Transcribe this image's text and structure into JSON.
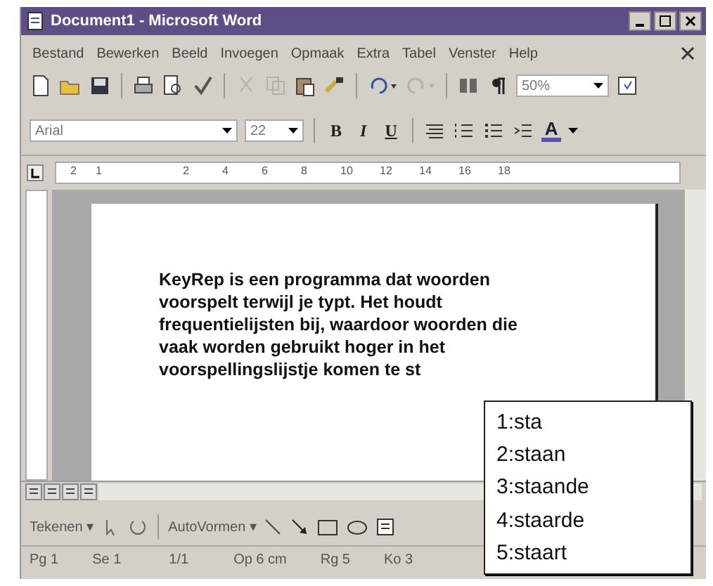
{
  "window": {
    "title": "Document1 - Microsoft Word"
  },
  "menu": [
    "Bestand",
    "Bewerken",
    "Beeld",
    "Invoegen",
    "Opmaak",
    "Extra",
    "Tabel",
    "Venster",
    "Help"
  ],
  "standard_toolbar": {
    "zoom": "50%"
  },
  "formatting_toolbar": {
    "font": "Arial",
    "size": "22",
    "style_buttons": [
      "B",
      "I",
      "U"
    ],
    "font_color_button": "A"
  },
  "ruler": {
    "labels": [
      "2",
      "1",
      "2",
      "4",
      "6",
      "8",
      "10",
      "12",
      "14",
      "16",
      "18"
    ]
  },
  "document": {
    "lines": [
      "KeyRep is een programma dat woorden",
      "voorspelt terwijl je typt. Het houdt",
      "frequentielijsten bij, waardoor woorden die",
      "vaak worden gebruikt hoger in het",
      "voorspellingslijstje komen te st"
    ]
  },
  "drawing_toolbar": {
    "draw_menu": "Tekenen ▾",
    "autoshapes_menu": "AutoVormen ▾"
  },
  "status_bar": [
    "Pg 1",
    "Se 1",
    "1/1",
    "Op 6 cm",
    "Rg 5",
    "Ko 3"
  ],
  "prediction_list": [
    "1:sta",
    "2:staan",
    "3:staande",
    "4:staarde",
    "5:staart"
  ]
}
